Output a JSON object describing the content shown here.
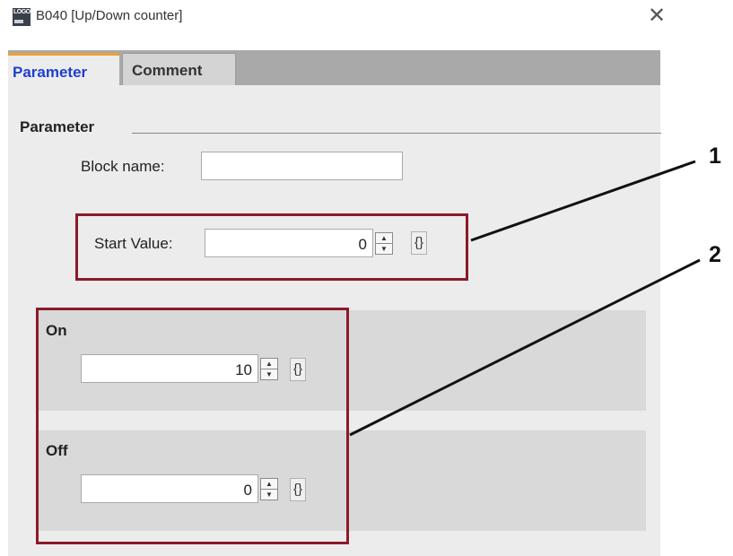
{
  "window": {
    "title": "B040 [Up/Down counter]",
    "icon": "logo-icon",
    "close_icon": "close-icon"
  },
  "tabs": [
    {
      "label": "Parameter",
      "active": true
    },
    {
      "label": "Comment",
      "active": false
    }
  ],
  "parameter": {
    "section_title": "Parameter",
    "block_name_label": "Block name:",
    "block_name_value": "",
    "start_value_label": "Start Value:",
    "start_value": "0"
  },
  "on_group": {
    "title": "On",
    "value": "10"
  },
  "off_group": {
    "title": "Off",
    "value": "0"
  },
  "callouts": [
    "1",
    "2"
  ],
  "colors": {
    "highlight_box": "#8b1a2a",
    "active_tab_text": "#1e3fd0",
    "tab_accent": "#f0a030"
  }
}
